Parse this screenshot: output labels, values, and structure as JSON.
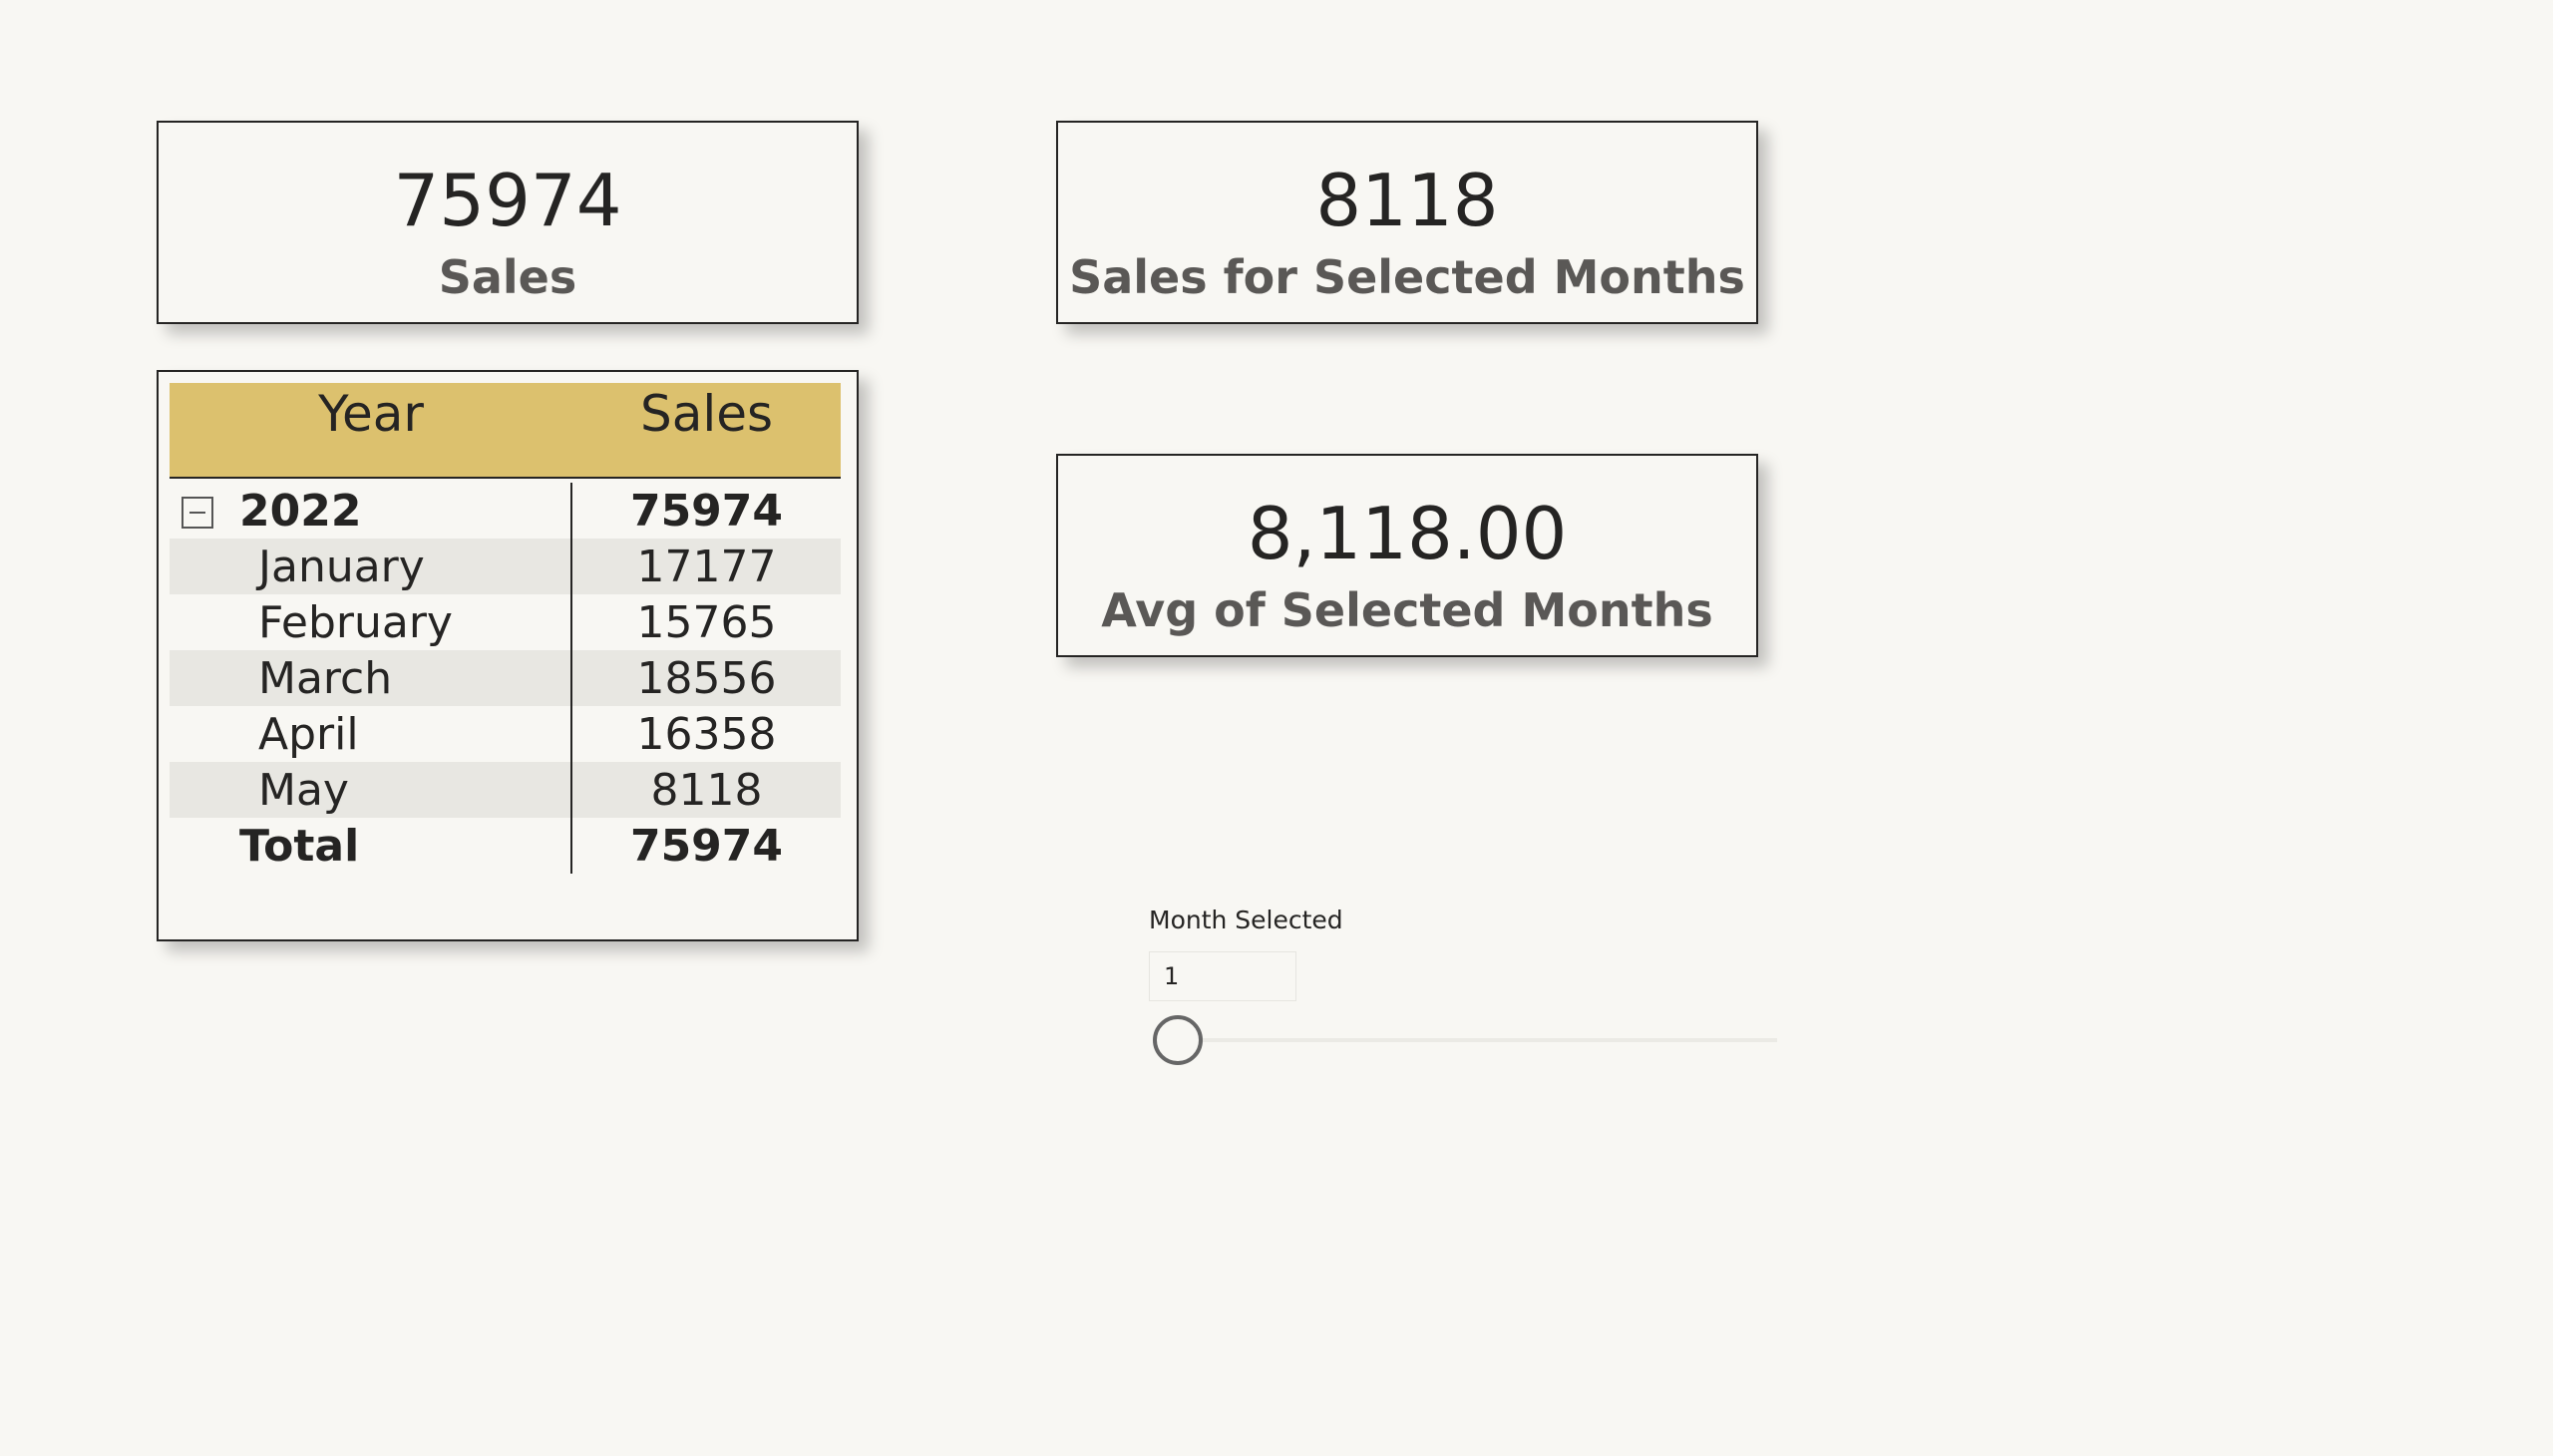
{
  "cards": {
    "sales": {
      "value": "75974",
      "label": "Sales"
    },
    "selected": {
      "value": "8118",
      "label": "Sales for Selected Months"
    },
    "avg": {
      "value": "8,118.00",
      "label": "Avg of Selected Months"
    }
  },
  "matrix": {
    "header_color": "#dcc16e",
    "columns": {
      "year": "Year",
      "sales": "Sales"
    },
    "group": {
      "label": "2022",
      "value": "75974",
      "expanded": true
    },
    "rows": [
      {
        "label": "January",
        "value": "17177"
      },
      {
        "label": "February",
        "value": "15765"
      },
      {
        "label": "March",
        "value": "18556"
      },
      {
        "label": "April",
        "value": "16358"
      },
      {
        "label": "May",
        "value": "8118"
      }
    ],
    "total": {
      "label": "Total",
      "value": "75974"
    }
  },
  "slicer": {
    "title": "Month Selected",
    "value": "1",
    "slider_fraction": 0
  }
}
